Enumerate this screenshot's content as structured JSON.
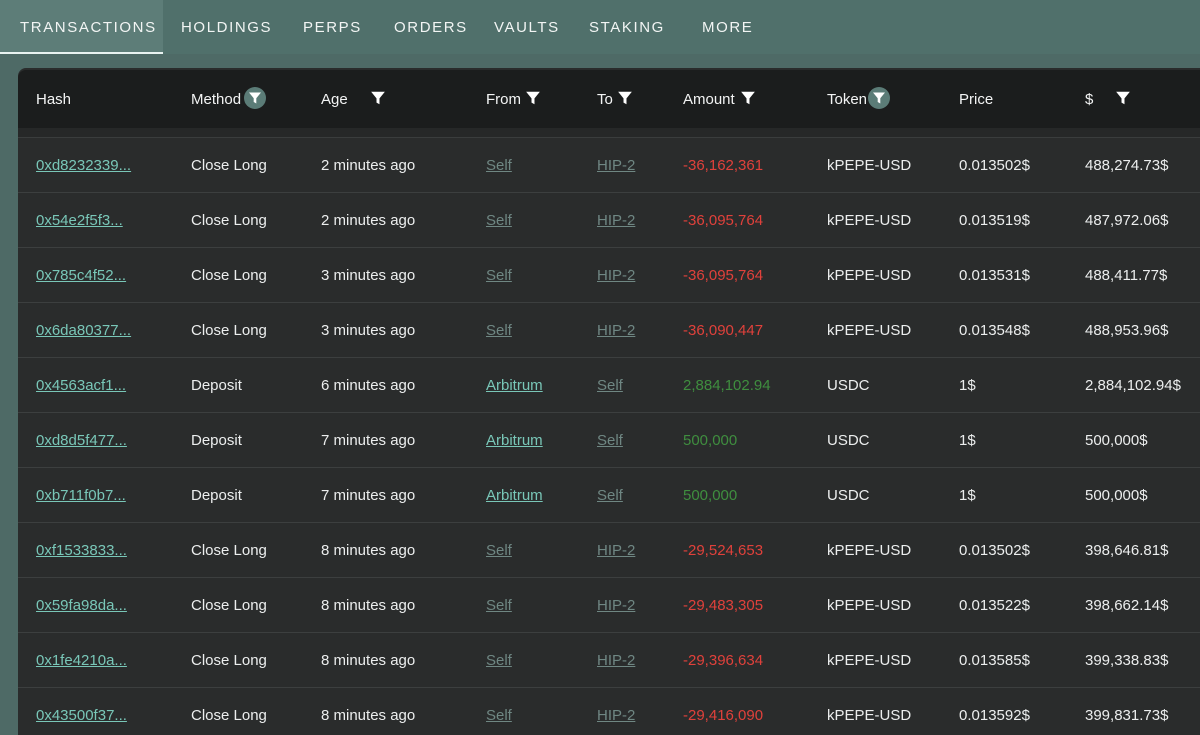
{
  "tabs": [
    {
      "label": "TRANSACTIONS",
      "active": true
    },
    {
      "label": "HOLDINGS"
    },
    {
      "label": "PERPS"
    },
    {
      "label": "ORDERS"
    },
    {
      "label": "VAULTS"
    },
    {
      "label": "STAKING"
    },
    {
      "label": "MORE"
    }
  ],
  "table": {
    "headers": {
      "hash": "Hash",
      "method": "Method",
      "age": "Age",
      "from": "From",
      "to": "To",
      "amount": "Amount",
      "token": "Token",
      "price": "Price",
      "usd": "$"
    },
    "rows": [
      {
        "hash": "0xd8232339...",
        "method": "Close Long",
        "age": "2 minutes ago",
        "from": "Self",
        "to": "HIP-2",
        "amount": "-36,162,361",
        "token": "kPEPE-USD",
        "price": "0.013502$",
        "usd": "488,274.73$"
      },
      {
        "hash": "0x54e2f5f3...",
        "method": "Close Long",
        "age": "2 minutes ago",
        "from": "Self",
        "to": "HIP-2",
        "amount": "-36,095,764",
        "token": "kPEPE-USD",
        "price": "0.013519$",
        "usd": "487,972.06$"
      },
      {
        "hash": "0x785c4f52...",
        "method": "Close Long",
        "age": "3 minutes ago",
        "from": "Self",
        "to": "HIP-2",
        "amount": "-36,095,764",
        "token": "kPEPE-USD",
        "price": "0.013531$",
        "usd": "488,411.77$"
      },
      {
        "hash": "0x6da80377...",
        "method": "Close Long",
        "age": "3 minutes ago",
        "from": "Self",
        "to": "HIP-2",
        "amount": "-36,090,447",
        "token": "kPEPE-USD",
        "price": "0.013548$",
        "usd": "488,953.96$"
      },
      {
        "hash": "0x4563acf1...",
        "method": "Deposit",
        "age": "6 minutes ago",
        "from": "Arbitrum",
        "to": "Self",
        "amount": "2,884,102.94",
        "token": "USDC",
        "price": "1$",
        "usd": "2,884,102.94$"
      },
      {
        "hash": "0xd8d5f477...",
        "method": "Deposit",
        "age": "7 minutes ago",
        "from": "Arbitrum",
        "to": "Self",
        "amount": "500,000",
        "token": "USDC",
        "price": "1$",
        "usd": "500,000$"
      },
      {
        "hash": "0xb711f0b7...",
        "method": "Deposit",
        "age": "7 minutes ago",
        "from": "Arbitrum",
        "to": "Self",
        "amount": "500,000",
        "token": "USDC",
        "price": "1$",
        "usd": "500,000$"
      },
      {
        "hash": "0xf1533833...",
        "method": "Close Long",
        "age": "8 minutes ago",
        "from": "Self",
        "to": "HIP-2",
        "amount": "-29,524,653",
        "token": "kPEPE-USD",
        "price": "0.013502$",
        "usd": "398,646.81$"
      },
      {
        "hash": "0x59fa98da...",
        "method": "Close Long",
        "age": "8 minutes ago",
        "from": "Self",
        "to": "HIP-2",
        "amount": "-29,483,305",
        "token": "kPEPE-USD",
        "price": "0.013522$",
        "usd": "398,662.14$"
      },
      {
        "hash": "0x1fe4210a...",
        "method": "Close Long",
        "age": "8 minutes ago",
        "from": "Self",
        "to": "HIP-2",
        "amount": "-29,396,634",
        "token": "kPEPE-USD",
        "price": "0.013585$",
        "usd": "399,338.83$"
      },
      {
        "hash": "0x43500f37...",
        "method": "Close Long",
        "age": "8 minutes ago",
        "from": "Self",
        "to": "HIP-2",
        "amount": "-29,416,090",
        "token": "kPEPE-USD",
        "price": "0.013592$",
        "usd": "399,831.73$"
      }
    ]
  },
  "colors": {
    "link": "#79c7b8",
    "negative": "#e0413b",
    "positive": "#3f8e3f",
    "tab_bar": "#50706b",
    "panel": "#2a2c2c"
  }
}
